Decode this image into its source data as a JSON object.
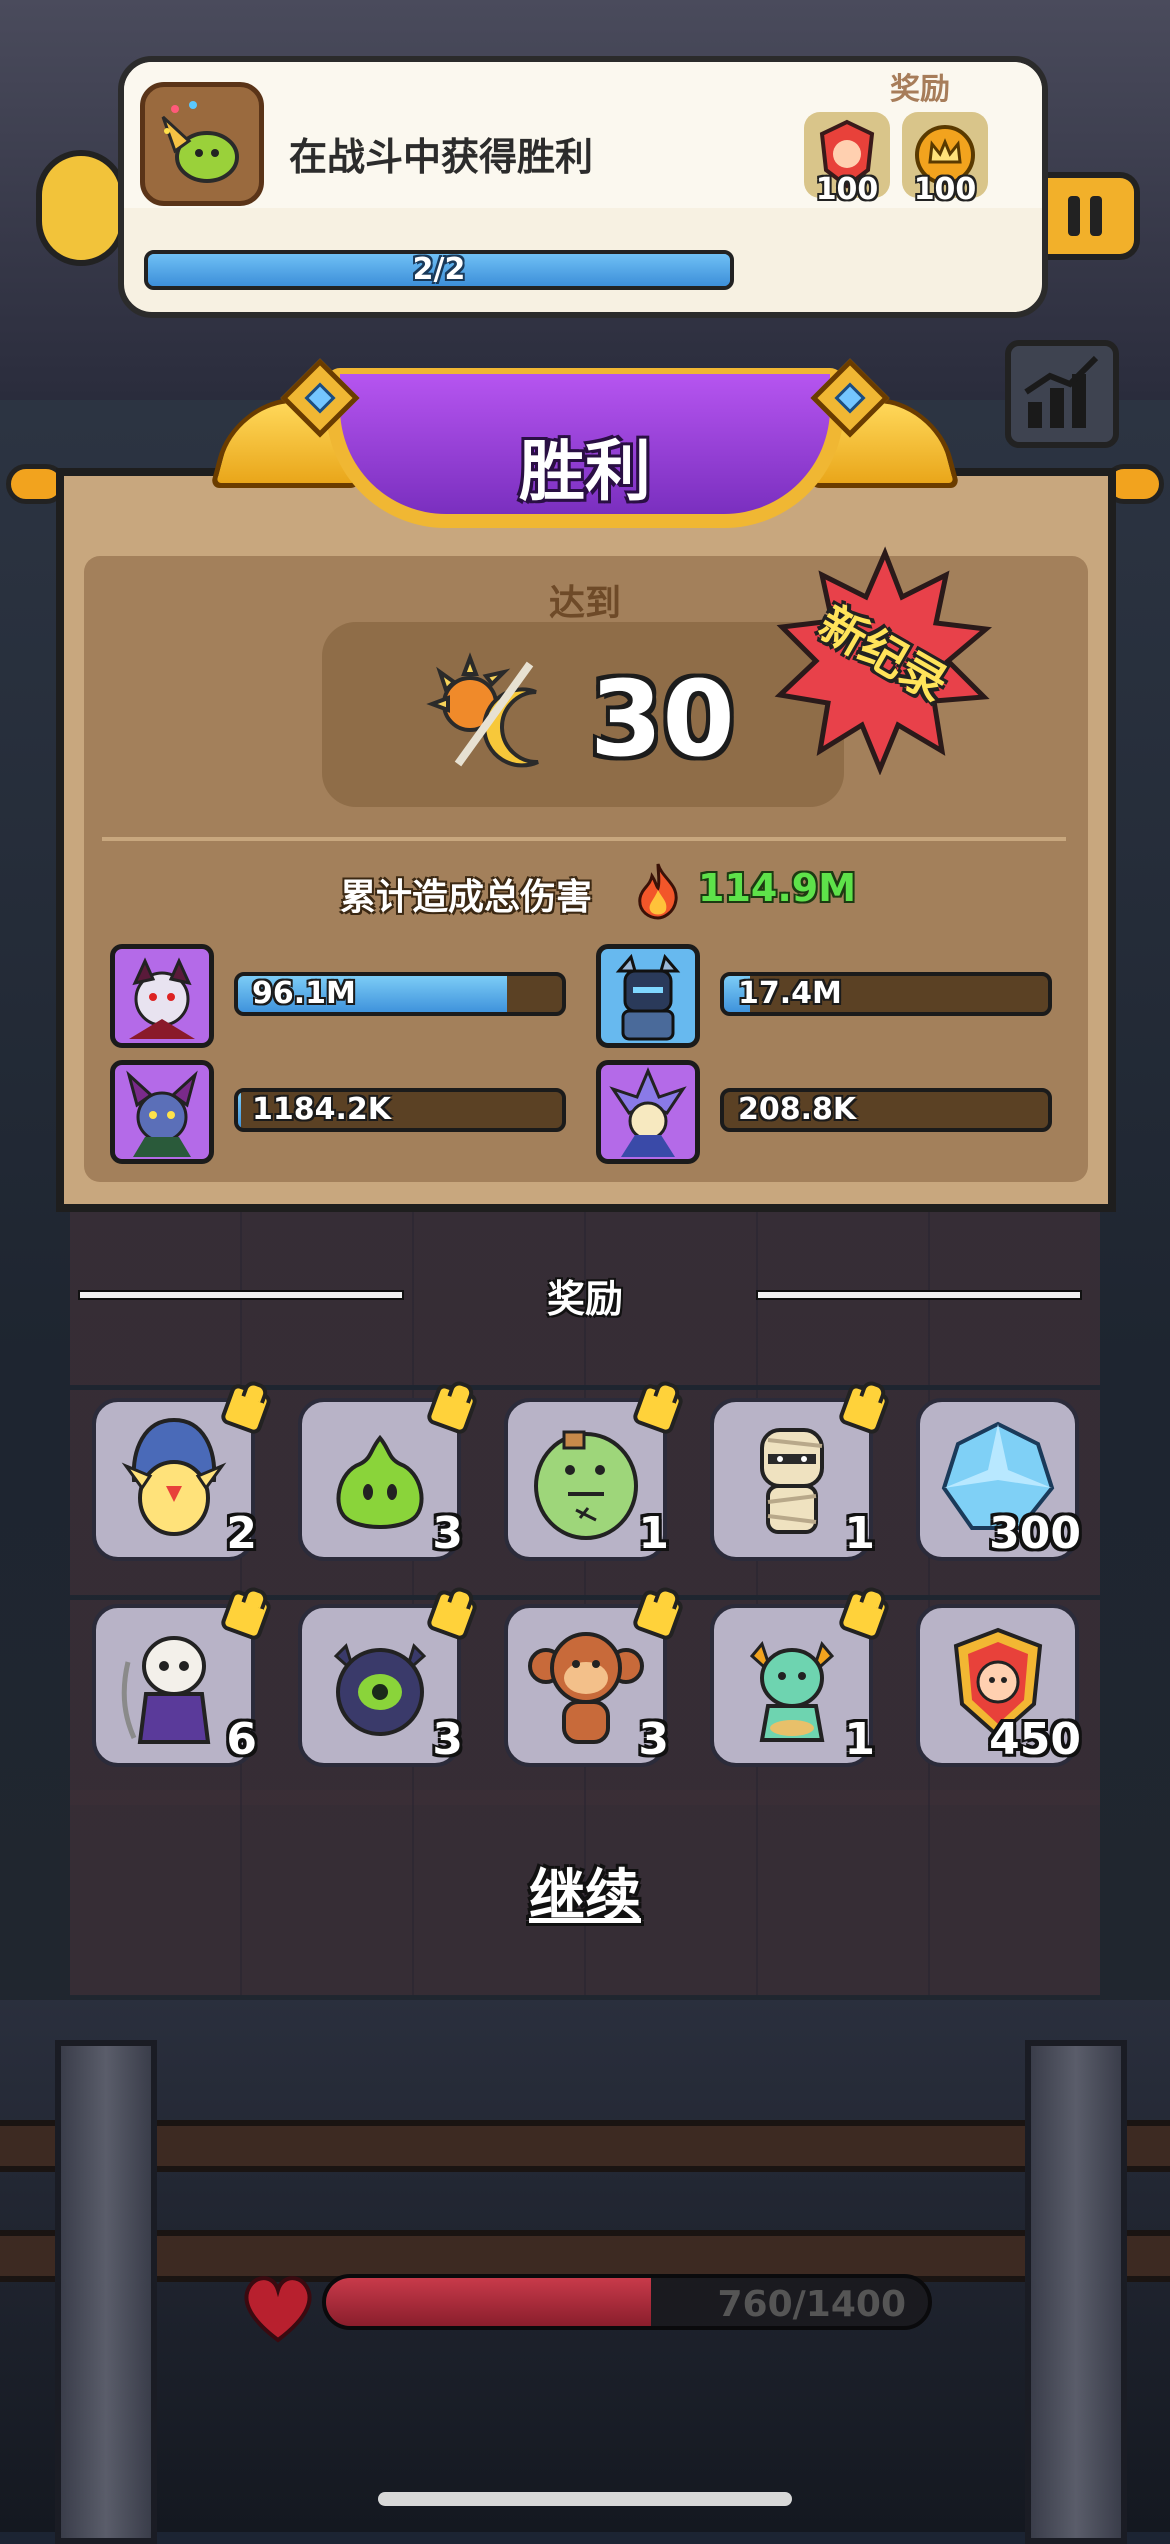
{
  "quest": {
    "title": "在战斗中获得胜利",
    "reward_label": "奖励",
    "rewards": [
      {
        "icon": "crest-shield-icon",
        "amount": "100"
      },
      {
        "icon": "crown-coin-icon",
        "amount": "100"
      }
    ],
    "progress_text": "2/2",
    "progress_fraction": 1.0
  },
  "result": {
    "title": "胜利",
    "reached_label": "达到",
    "score": "30",
    "new_record_label": "新纪录",
    "total_damage_label": "累计造成总伤害",
    "total_damage_value": "114.9M",
    "heroes": [
      {
        "icon": "demon-hero-icon",
        "damage": "96.1M",
        "fill": 0.83,
        "frame": "#b46ae8"
      },
      {
        "icon": "knight-hero-icon",
        "damage": "17.4M",
        "fill": 0.08,
        "frame": "#67b9ef"
      },
      {
        "icon": "horned-demon-hero-icon",
        "damage": "1184.2K",
        "fill": 0.01,
        "frame": "#b46ae8"
      },
      {
        "icon": "crystal-mage-hero-icon",
        "damage": "208.8K",
        "fill": 0.0,
        "frame": "#b46ae8"
      }
    ]
  },
  "rewards": {
    "heading": "奖励",
    "items": [
      {
        "icon": "hooded-bird-icon",
        "count": "2",
        "puzzle": true
      },
      {
        "icon": "green-slime-icon",
        "count": "3",
        "puzzle": true
      },
      {
        "icon": "green-ogre-icon",
        "count": "1",
        "puzzle": true
      },
      {
        "icon": "mummy-icon",
        "count": "1",
        "puzzle": true
      },
      {
        "icon": "ice-crystal-icon",
        "count": "300",
        "puzzle": false
      },
      {
        "icon": "skull-reaper-icon",
        "count": "6",
        "puzzle": true
      },
      {
        "icon": "dark-orb-icon",
        "count": "3",
        "puzzle": true
      },
      {
        "icon": "monkey-icon",
        "count": "3",
        "puzzle": true
      },
      {
        "icon": "sea-dragon-icon",
        "count": "1",
        "puzzle": true
      },
      {
        "icon": "crest-shield-icon",
        "count": "450",
        "puzzle": false
      }
    ]
  },
  "continue_label": "继续",
  "hp": {
    "text": "760/1400",
    "fraction": 0.54
  },
  "colors": {
    "accent_purple": "#8e3fd0",
    "gold": "#f0b733",
    "green_text": "#5ee24a",
    "bar_blue": "#3f93dc"
  }
}
